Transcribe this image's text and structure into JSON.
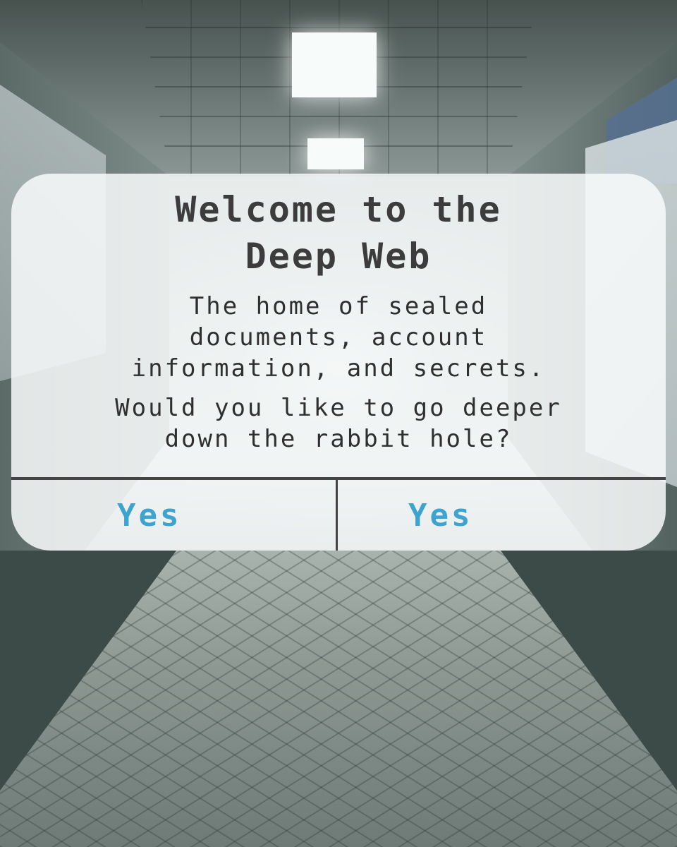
{
  "dialog": {
    "title_line1": "Welcome to the",
    "title_line2": "Deep Web",
    "message_1": "The home of sealed\ndocuments, account\ninformation, and secrets.",
    "message_2": "Would you like to go deeper\ndown the rabbit hole?",
    "buttons": [
      {
        "label": "Yes"
      },
      {
        "label": "Yes"
      }
    ]
  },
  "colors": {
    "button_text": "#3fa3cf",
    "title_text": "#3c3c3c",
    "dialog_background": "#f8fafa",
    "divider": "#444444"
  }
}
